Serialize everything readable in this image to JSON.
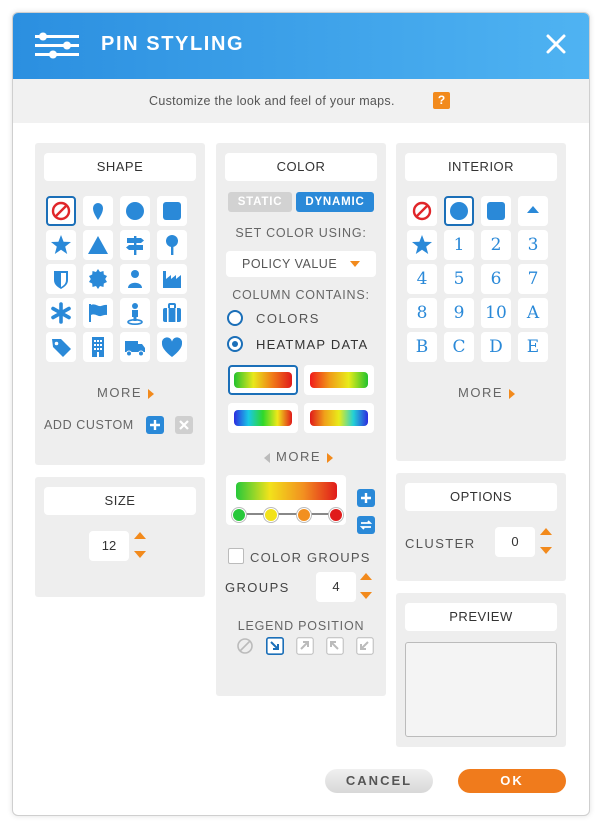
{
  "header": {
    "title": "PIN STYLING",
    "close_icon": "close-icon",
    "menu_icon": "sliders-icon"
  },
  "subheader": {
    "text": "Customize the look and feel of your maps.",
    "help": "?"
  },
  "shape": {
    "title": "SHAPE",
    "icons": [
      "no-shape-icon",
      "map-marker-icon",
      "circle-icon",
      "square-icon",
      "star-icon",
      "triangle-icon",
      "signpost-icon",
      "pushpin-icon",
      "shield-icon",
      "badge-icon",
      "person-icon",
      "factory-icon",
      "asterisk-icon",
      "flag-icon",
      "person-pin-icon",
      "suitcase-icon",
      "tag-icon",
      "building-icon",
      "truck-icon",
      "heart-icon"
    ],
    "selected_index": 0,
    "more": "MORE",
    "add_custom": "ADD CUSTOM"
  },
  "size": {
    "title": "SIZE",
    "value": "12"
  },
  "color": {
    "title": "COLOR",
    "static_label": "STATIC",
    "dynamic_label": "DYNAMIC",
    "set_using_label": "SET COLOR USING:",
    "set_using_value": "POLICY VALUE",
    "column_contains_label": "COLUMN CONTAINS:",
    "option_colors": "COLORS",
    "option_heatmap": "HEATMAP DATA",
    "selected_option": "HEATMAP DATA",
    "more": "MORE",
    "color_groups_label": "COLOR GROUPS",
    "groups_label": "GROUPS",
    "groups_value": "4",
    "legend_position_label": "LEGEND POSITION",
    "legend_positions": [
      "none-icon",
      "bottom-right-icon",
      "top-right-icon",
      "top-left-icon",
      "bottom-left-icon"
    ],
    "legend_selected_index": 1,
    "gradient_stops": [
      "#27c83a",
      "#f2e21b",
      "#f29020",
      "#e01b1b"
    ]
  },
  "interior": {
    "title": "INTERIOR",
    "labels": [
      "",
      "",
      "",
      "",
      "",
      "1",
      "2",
      "3",
      "4",
      "5",
      "6",
      "7",
      "8",
      "9",
      "10",
      "A",
      "B",
      "C",
      "D",
      "E"
    ],
    "icons": [
      "no-interior-icon",
      "circle-icon",
      "square-icon",
      "triangle-icon",
      "star-icon"
    ],
    "selected_index": 1,
    "more": "MORE"
  },
  "options": {
    "title": "OPTIONS",
    "cluster_label": "CLUSTER",
    "cluster_value": "0"
  },
  "preview": {
    "title": "PREVIEW"
  },
  "footer": {
    "cancel": "CANCEL",
    "ok": "OK"
  },
  "colors": {
    "accent_blue": "#2a89d8",
    "accent_orange": "#f28a1c",
    "dark_blue": "#1b6fb8"
  }
}
